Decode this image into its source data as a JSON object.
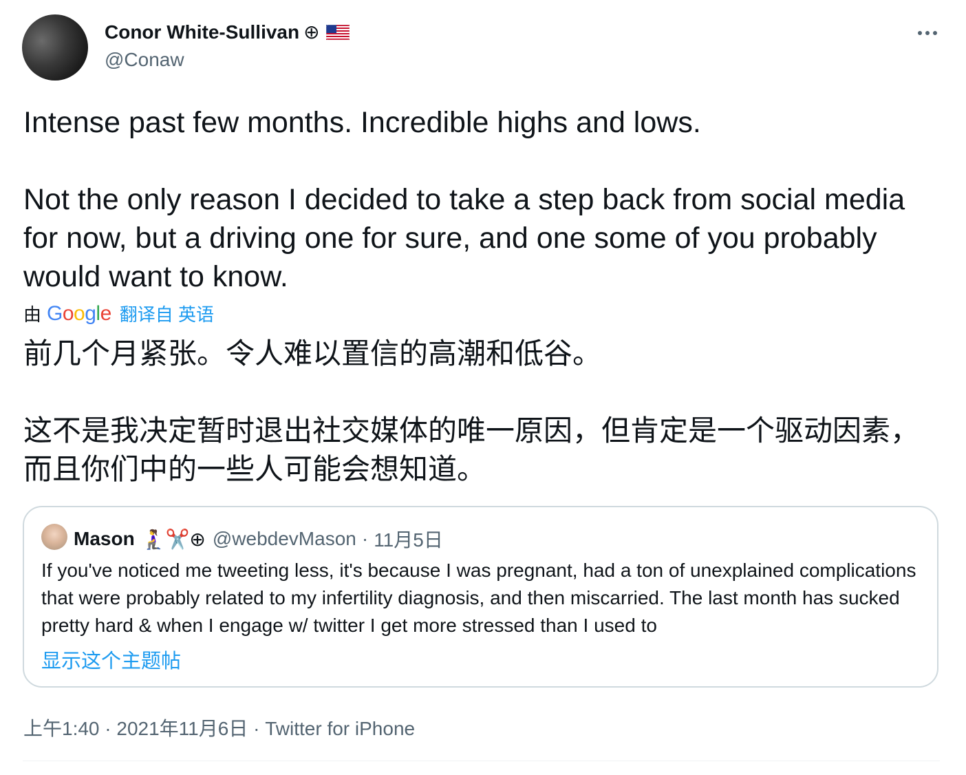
{
  "author": {
    "display_name": "Conor White-Sullivan",
    "name_badges": "⊕",
    "handle": "@Conaw"
  },
  "tweet": {
    "text": "Intense past few months. Incredible highs and lows.\n\nNot the only reason I decided to take a step back from social media for now, but a driving one for sure, and one some of you probably would want to know."
  },
  "translation": {
    "by_label": "由",
    "provider": "Google",
    "link_label": "翻译自 英语",
    "text": "前几个月紧张。令人难以置信的高潮和低谷。\n\n这不是我决定暂时退出社交媒体的唯一原因，但肯定是一个驱动因素，而且你们中的一些人可能会想知道。"
  },
  "quoted_tweet": {
    "display_name": "Mason",
    "name_emojis": "🧎‍♀️✂️⊕",
    "handle": "@webdevMason",
    "separator": "·",
    "date": "11月5日",
    "text": "If you've noticed me tweeting less, it's because I was pregnant, had a ton of unexplained complications that were probably related to my infertility diagnosis, and then miscarried. The last month has sucked pretty hard & when I engage w/ twitter I get more stressed than I used to",
    "show_thread_label": "显示这个主题帖"
  },
  "meta": {
    "time": "上午1:40",
    "sep1": "·",
    "date": "2021年11月6日",
    "sep2": "·",
    "source": "Twitter for iPhone"
  },
  "colors": {
    "text": "#0f1419",
    "secondary": "#536471",
    "link": "#1d9bf0",
    "border": "#cfd9de"
  },
  "icons": {
    "more": "more-horizontal-icon",
    "flag": "us-flag-icon"
  }
}
